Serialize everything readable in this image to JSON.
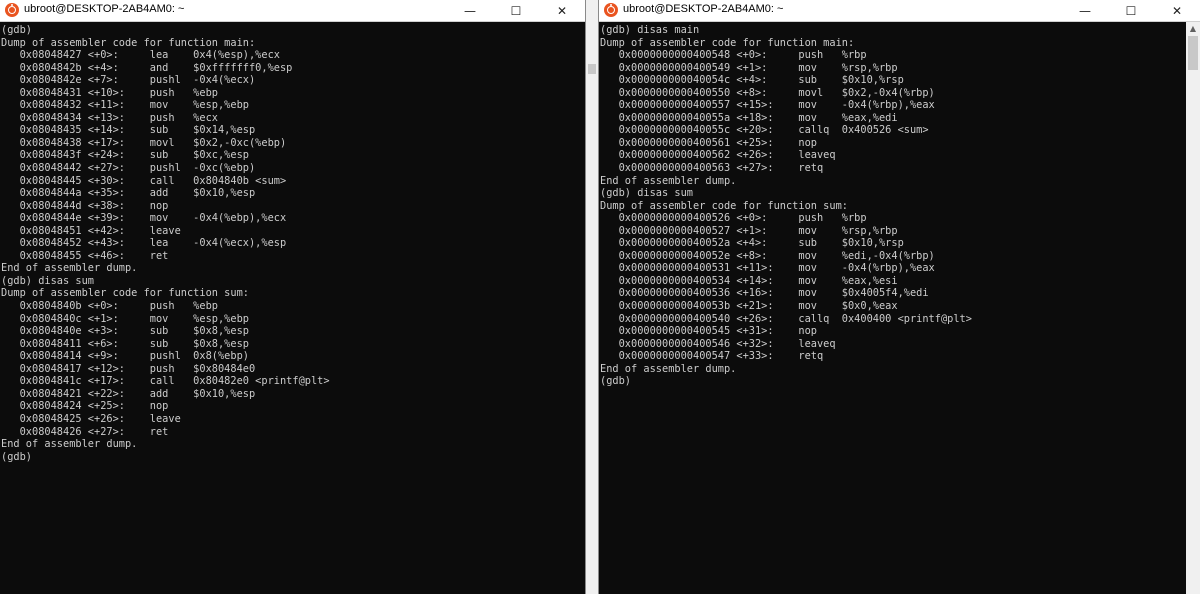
{
  "left_window": {
    "title": "ubroot@DESKTOP-2AB4AM0: ~",
    "lines": [
      "(gdb)",
      "Dump of assembler code for function main:",
      "   0x08048427 <+0>:     lea    0x4(%esp),%ecx",
      "   0x0804842b <+4>:     and    $0xfffffff0,%esp",
      "   0x0804842e <+7>:     pushl  -0x4(%ecx)",
      "   0x08048431 <+10>:    push   %ebp",
      "   0x08048432 <+11>:    mov    %esp,%ebp",
      "   0x08048434 <+13>:    push   %ecx",
      "   0x08048435 <+14>:    sub    $0x14,%esp",
      "   0x08048438 <+17>:    movl   $0x2,-0xc(%ebp)",
      "   0x0804843f <+24>:    sub    $0xc,%esp",
      "   0x08048442 <+27>:    pushl  -0xc(%ebp)",
      "   0x08048445 <+30>:    call   0x804840b <sum>",
      "   0x0804844a <+35>:    add    $0x10,%esp",
      "   0x0804844d <+38>:    nop",
      "   0x0804844e <+39>:    mov    -0x4(%ebp),%ecx",
      "   0x08048451 <+42>:    leave",
      "   0x08048452 <+43>:    lea    -0x4(%ecx),%esp",
      "   0x08048455 <+46>:    ret",
      "End of assembler dump.",
      "(gdb) disas sum",
      "Dump of assembler code for function sum:",
      "   0x0804840b <+0>:     push   %ebp",
      "   0x0804840c <+1>:     mov    %esp,%ebp",
      "   0x0804840e <+3>:     sub    $0x8,%esp",
      "   0x08048411 <+6>:     sub    $0x8,%esp",
      "   0x08048414 <+9>:     pushl  0x8(%ebp)",
      "   0x08048417 <+12>:    push   $0x80484e0",
      "   0x0804841c <+17>:    call   0x80482e0 <printf@plt>",
      "   0x08048421 <+22>:    add    $0x10,%esp",
      "   0x08048424 <+25>:    nop",
      "   0x08048425 <+26>:    leave",
      "   0x08048426 <+27>:    ret",
      "End of assembler dump.",
      "(gdb)"
    ]
  },
  "right_window": {
    "title": "ubroot@DESKTOP-2AB4AM0: ~",
    "lines": [
      "(gdb) disas main",
      "Dump of assembler code for function main:",
      "   0x0000000000400548 <+0>:     push   %rbp",
      "   0x0000000000400549 <+1>:     mov    %rsp,%rbp",
      "   0x000000000040054c <+4>:     sub    $0x10,%rsp",
      "   0x0000000000400550 <+8>:     movl   $0x2,-0x4(%rbp)",
      "   0x0000000000400557 <+15>:    mov    -0x4(%rbp),%eax",
      "   0x000000000040055a <+18>:    mov    %eax,%edi",
      "   0x000000000040055c <+20>:    callq  0x400526 <sum>",
      "   0x0000000000400561 <+25>:    nop",
      "   0x0000000000400562 <+26>:    leaveq",
      "   0x0000000000400563 <+27>:    retq",
      "End of assembler dump.",
      "(gdb) disas sum",
      "Dump of assembler code for function sum:",
      "   0x0000000000400526 <+0>:     push   %rbp",
      "   0x0000000000400527 <+1>:     mov    %rsp,%rbp",
      "   0x000000000040052a <+4>:     sub    $0x10,%rsp",
      "   0x000000000040052e <+8>:     mov    %edi,-0x4(%rbp)",
      "   0x0000000000400531 <+11>:    mov    -0x4(%rbp),%eax",
      "   0x0000000000400534 <+14>:    mov    %eax,%esi",
      "   0x0000000000400536 <+16>:    mov    $0x4005f4,%edi",
      "   0x000000000040053b <+21>:    mov    $0x0,%eax",
      "   0x0000000000400540 <+26>:    callq  0x400400 <printf@plt>",
      "   0x0000000000400545 <+31>:    nop",
      "   0x0000000000400546 <+32>:    leaveq",
      "   0x0000000000400547 <+33>:    retq",
      "End of assembler dump.",
      "(gdb)"
    ]
  },
  "controls": {
    "minimize": "—",
    "maximize": "☐",
    "close": "✕"
  },
  "colors": {
    "terminal_bg": "#0c0c0c",
    "terminal_fg": "#cccccc",
    "ubuntu_orange": "#e95420"
  },
  "icons": [
    "ubuntu-icon",
    "minimize-icon",
    "maximize-icon",
    "close-icon",
    "scroll-up-icon"
  ]
}
